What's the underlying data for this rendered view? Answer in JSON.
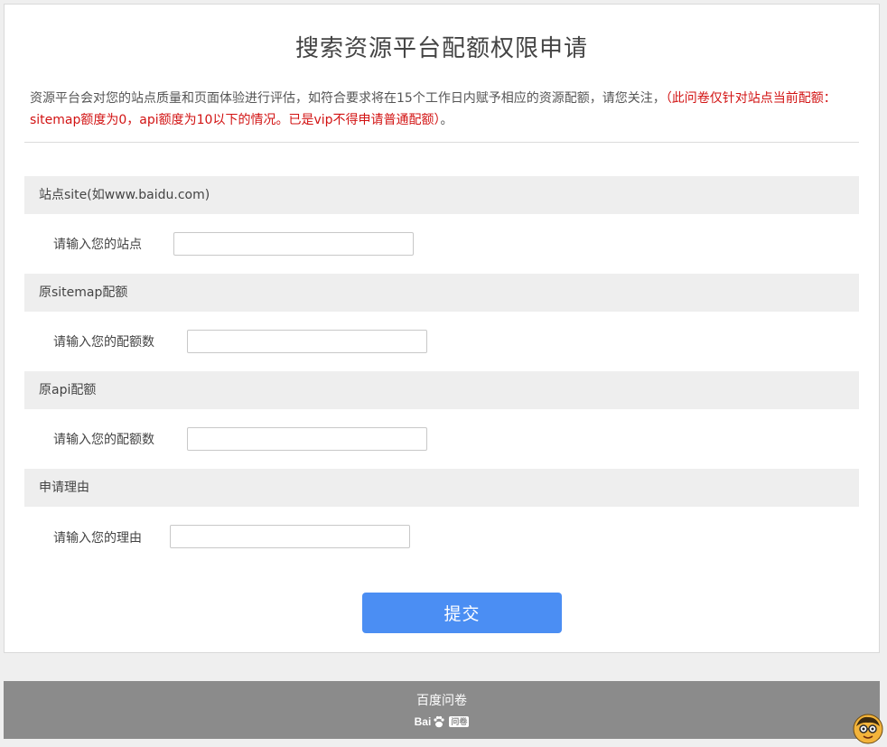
{
  "page": {
    "title": "搜索资源平台配额权限申请",
    "intro_text": "资源平台会对您的站点质量和页面体验进行评估，如符合要求将在15个工作日内赋予相应的资源配额，请您关注，",
    "intro_highlight": "（此问卷仅针对站点当前配额：sitemap额度为0，api额度为10以下的情况。已是vip不得申请普通配额）",
    "intro_tail": "。"
  },
  "questions": [
    {
      "section": "站点site(如www.baidu.com)",
      "label": "请输入您的站点"
    },
    {
      "section": "原sitemap配额",
      "label": "请输入您的配额数"
    },
    {
      "section": "原api配额",
      "label": "请输入您的配额数"
    },
    {
      "section": "申请理由",
      "label": "请输入您的理由"
    }
  ],
  "form": {
    "submit_label": "提交"
  },
  "footer": {
    "title": "百度问卷",
    "logo_text": "Bai",
    "logo_suffix": "问卷"
  },
  "colors": {
    "accent": "#4b8ef3",
    "highlight": "#d21313",
    "footer_bg": "#8b8b8b"
  }
}
